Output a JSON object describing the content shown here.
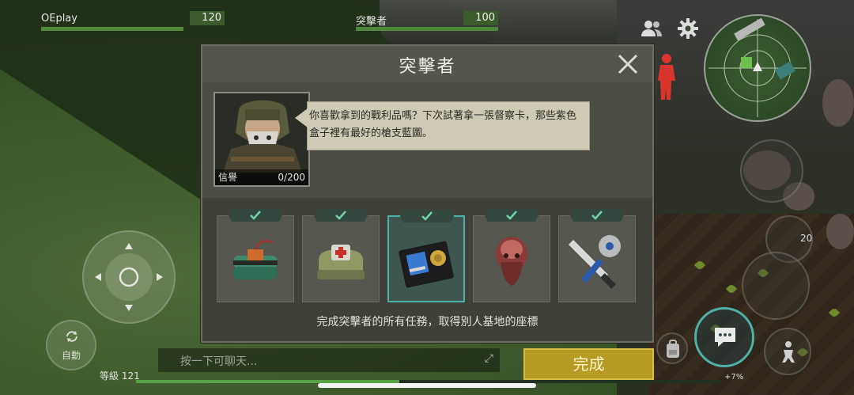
{
  "hud": {
    "player_name": "OEplay",
    "player_hp": "120",
    "enemy_name": "突擊者",
    "enemy_hp": "100"
  },
  "dialog": {
    "title": "突擊者",
    "reputation_label": "信譽",
    "reputation_value": "0/200",
    "speech_text": "你喜歡拿到的戰利品嗎？下次試著拿一張督察卡，那些紫色盒子裡有最好的槍支藍圖。",
    "rewards": [
      {
        "name": "炸藥"
      },
      {
        "name": "醫療包"
      },
      {
        "name": "督察卡"
      },
      {
        "name": "面具"
      },
      {
        "name": "武器"
      }
    ],
    "rewards_caption": "完成突擊者的所有任務，取得別人基地的座標",
    "complete_label": "完成"
  },
  "bottom": {
    "auto_label": "自動",
    "chat_placeholder": "按一下可聊天...",
    "level_label": "等級 121",
    "xp_percent": "+7%",
    "xp_fill": 0.45
  },
  "side": {
    "count_label": "20"
  },
  "colors": {
    "accent_teal": "#4fb0a8",
    "button_gold": "#b79a24",
    "hp_green": "#4f8a3a"
  }
}
